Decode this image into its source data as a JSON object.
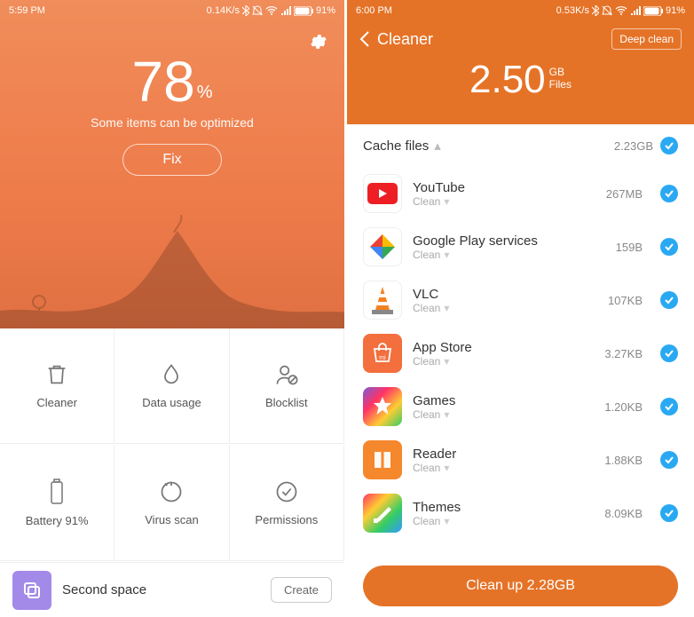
{
  "left": {
    "statusbar": {
      "time": "5:59 PM",
      "speed": "0.14K/s",
      "battery": "91%"
    },
    "score": "78",
    "percent": "%",
    "subtitle": "Some items can be optimized",
    "fix": "Fix",
    "grid": [
      {
        "label": "Cleaner"
      },
      {
        "label": "Data usage"
      },
      {
        "label": "Blocklist"
      },
      {
        "label": "Battery 91%"
      },
      {
        "label": "Virus scan"
      },
      {
        "label": "Permissions"
      }
    ],
    "second_space": {
      "title": "Second space",
      "action": "Create"
    }
  },
  "right": {
    "statusbar": {
      "time": "6:00 PM",
      "speed": "0.53K/s",
      "battery": "91%"
    },
    "nav": {
      "title": "Cleaner",
      "deep": "Deep clean"
    },
    "total": {
      "num": "2.50",
      "gb": "GB",
      "files": "Files"
    },
    "section": {
      "name": "Cache files",
      "size": "2.23GB"
    },
    "apps": [
      {
        "name": "YouTube",
        "sub": "Clean",
        "size": "267MB",
        "iconClass": "ic-youtube"
      },
      {
        "name": "Google Play services",
        "sub": "Clean",
        "size": "159B",
        "iconClass": "ic-play"
      },
      {
        "name": "VLC",
        "sub": "Clean",
        "size": "107KB",
        "iconClass": "ic-vlc"
      },
      {
        "name": "App Store",
        "sub": "Clean",
        "size": "3.27KB",
        "iconClass": "ic-appstore"
      },
      {
        "name": "Games",
        "sub": "Clean",
        "size": "1.20KB",
        "iconClass": "ic-games"
      },
      {
        "name": "Reader",
        "sub": "Clean",
        "size": "1.88KB",
        "iconClass": "ic-reader"
      },
      {
        "name": "Themes",
        "sub": "Clean",
        "size": "8.09KB",
        "iconClass": "ic-themes"
      }
    ],
    "clean_btn": "Clean up 2.28GB"
  }
}
